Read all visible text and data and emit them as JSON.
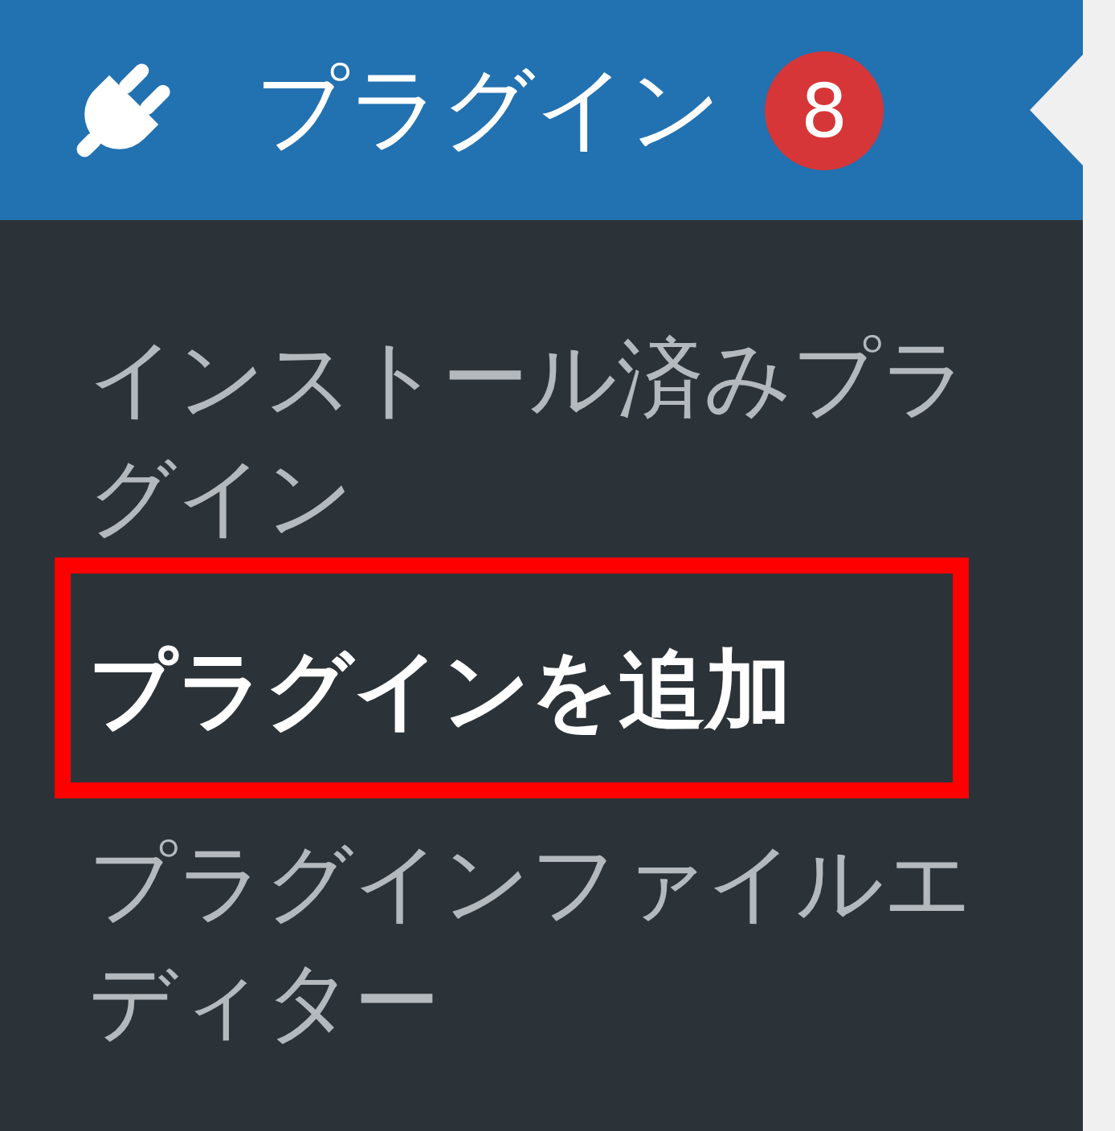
{
  "menu": {
    "title": "プラグイン",
    "badge": "8",
    "current": true
  },
  "submenu": [
    {
      "label": "インストール済みプラグイン",
      "selected": false,
      "highlighted": false
    },
    {
      "label": "プラグインを追加",
      "selected": true,
      "highlighted": true
    },
    {
      "label": "プラグインファイルエディター",
      "selected": false,
      "highlighted": false
    }
  ]
}
